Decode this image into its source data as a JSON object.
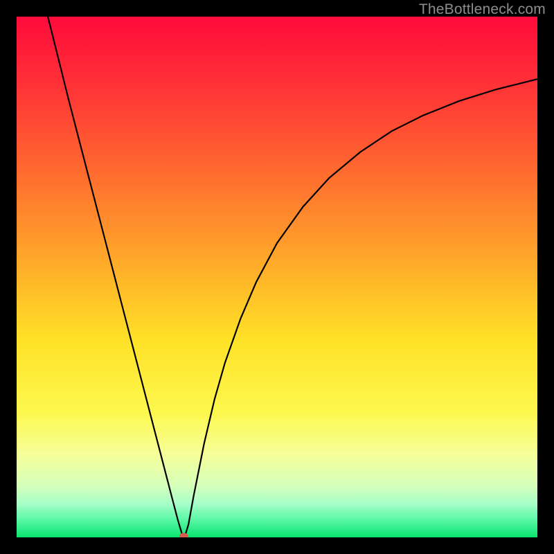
{
  "watermark": "TheBottleneck.com",
  "chart_data": {
    "type": "line",
    "title": "",
    "xlabel": "",
    "ylabel": "",
    "xlim": [
      0,
      100
    ],
    "ylim": [
      0,
      100
    ],
    "grid": false,
    "legend": false,
    "background_gradient": {
      "stops": [
        {
          "offset": 0.0,
          "color": "#ff0b3a"
        },
        {
          "offset": 0.12,
          "color": "#ff2e37"
        },
        {
          "offset": 0.3,
          "color": "#ff6b2f"
        },
        {
          "offset": 0.48,
          "color": "#ffad29"
        },
        {
          "offset": 0.62,
          "color": "#ffe127"
        },
        {
          "offset": 0.76,
          "color": "#fdf84e"
        },
        {
          "offset": 0.84,
          "color": "#f6ff99"
        },
        {
          "offset": 0.9,
          "color": "#d6ffba"
        },
        {
          "offset": 0.935,
          "color": "#a8ffc8"
        },
        {
          "offset": 0.965,
          "color": "#5cf7a7"
        },
        {
          "offset": 1.0,
          "color": "#09e46f"
        }
      ]
    },
    "series": [
      {
        "name": "bottleneck-curve",
        "color": "#000000",
        "width": 2.2,
        "x": [
          6.0,
          8.0,
          10.0,
          12.0,
          14.0,
          16.0,
          18.0,
          20.0,
          22.0,
          24.0,
          26.0,
          28.0,
          30.0,
          31.0,
          31.8,
          32.4,
          33.0,
          34.0,
          36.0,
          38.0,
          40.0,
          43.0,
          46.0,
          50.0,
          55.0,
          60.0,
          66.0,
          72.0,
          78.0,
          85.0,
          92.0,
          100.0
        ],
        "y": [
          100.0,
          92.0,
          84.0,
          76.3,
          68.6,
          60.9,
          53.2,
          45.5,
          37.8,
          30.1,
          22.4,
          14.7,
          7.0,
          3.2,
          0.5,
          0.5,
          2.5,
          8.0,
          18.0,
          26.5,
          33.5,
          42.0,
          49.0,
          56.5,
          63.5,
          69.0,
          74.0,
          78.0,
          81.0,
          83.8,
          86.0,
          88.0
        ]
      }
    ],
    "marker": {
      "name": "optimal-point",
      "x": 32.1,
      "y": 0.3,
      "rx": 0.85,
      "ry": 0.55,
      "fill": "#d65a4e"
    }
  }
}
